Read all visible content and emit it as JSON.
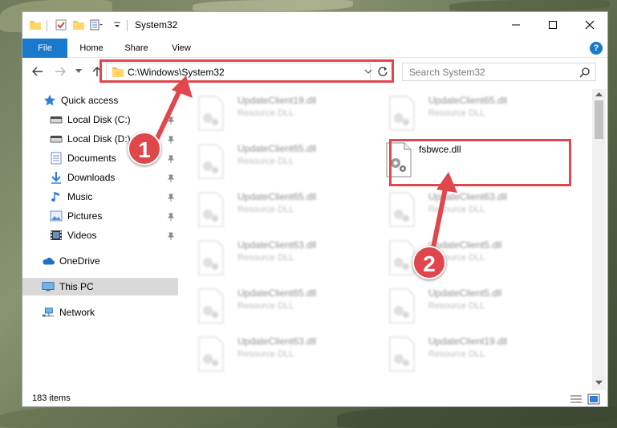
{
  "window": {
    "title": "System32"
  },
  "ribbon": {
    "tabs": [
      {
        "label": "File"
      },
      {
        "label": "Home"
      },
      {
        "label": "Share"
      },
      {
        "label": "View"
      }
    ],
    "help_label": "?"
  },
  "navigation": {
    "address_path": "C:\\Windows\\System32",
    "search_placeholder": "Search System32"
  },
  "sidebar": {
    "items": [
      {
        "label": "Quick access",
        "icon": "star-icon"
      },
      {
        "label": "Local Disk (C:)",
        "icon": "drive-icon",
        "pinned": true
      },
      {
        "label": "Local Disk (D:)",
        "icon": "drive-icon",
        "pinned": true
      },
      {
        "label": "Documents",
        "icon": "documents-icon",
        "pinned": true
      },
      {
        "label": "Downloads",
        "icon": "download-icon",
        "pinned": true
      },
      {
        "label": "Music",
        "icon": "music-icon",
        "pinned": true
      },
      {
        "label": "Pictures",
        "icon": "pictures-icon",
        "pinned": true
      },
      {
        "label": "Videos",
        "icon": "videos-icon",
        "pinned": true
      },
      {
        "label": "OneDrive",
        "icon": "cloud-icon"
      },
      {
        "label": "This PC",
        "icon": "computer-icon",
        "selected": true
      },
      {
        "label": "Network",
        "icon": "network-icon"
      }
    ]
  },
  "files": {
    "left_column": [
      {
        "name": "UpdateClient19.dll",
        "type": "Resource DLL"
      },
      {
        "name": "UpdateClient65.dll",
        "type": "Resource DLL"
      },
      {
        "name": "UpdateClient65.dll",
        "type": "Resource DLL"
      },
      {
        "name": "UpdateClient63.dll",
        "type": "Resource DLL"
      },
      {
        "name": "UpdateClient65.dll",
        "type": "Resource DLL"
      },
      {
        "name": "UpdateClient63.dll",
        "type": "Resource DLL"
      }
    ],
    "right_column": [
      {
        "name": "UpdateClient65.dll",
        "type": "Resource DLL"
      },
      {
        "name": "fsbwce.dll",
        "type": "",
        "highlighted": true
      },
      {
        "name": "UpdateClient63.dll",
        "type": "Resource DLL"
      },
      {
        "name": "UpdateClient5.dll",
        "type": "Resource DLL"
      },
      {
        "name": "UpdateClient5.dll",
        "type": "Resource DLL"
      },
      {
        "name": "UpdateClient19.dll",
        "type": "Resource DLL"
      }
    ]
  },
  "status": {
    "item_count": "183 items"
  },
  "annotations": {
    "callout_1": "1",
    "callout_2": "2",
    "accent_color": "#e0474c"
  },
  "colors": {
    "ribbon_file_tab": "#1979ca",
    "selected_sidebar": "#d9d9d9"
  }
}
